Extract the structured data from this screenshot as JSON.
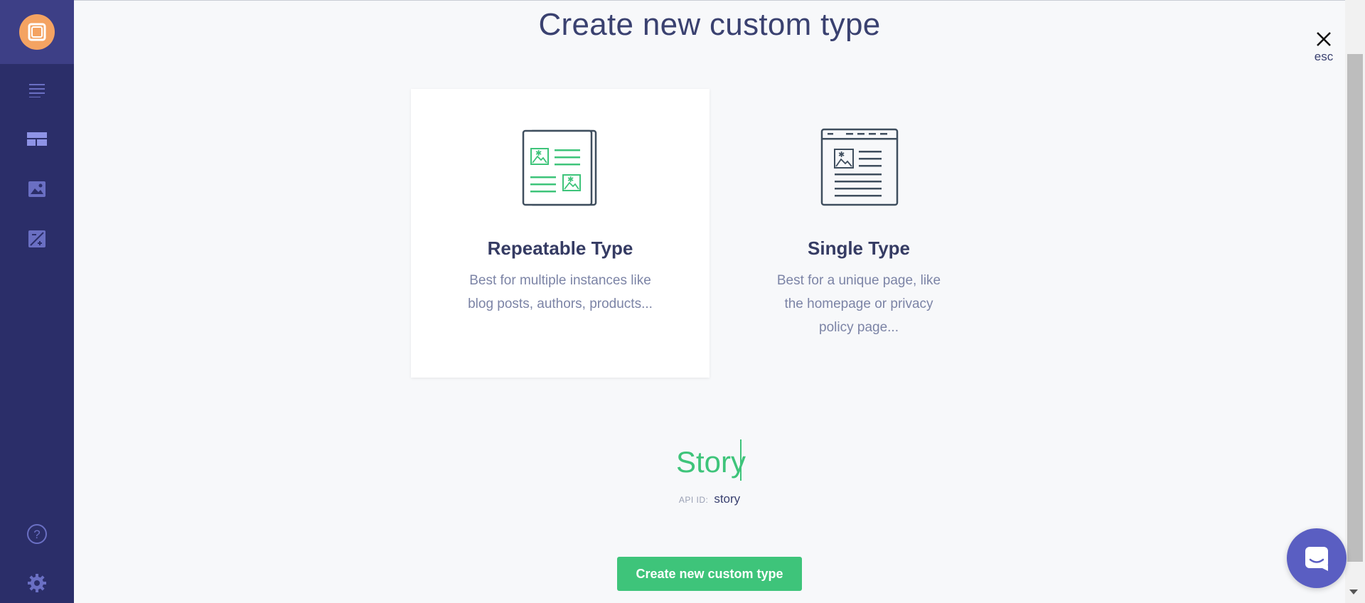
{
  "header": {
    "title": "Create new custom type",
    "close_label": "esc"
  },
  "cards": [
    {
      "title": "Repeatable Type",
      "description": "Best for multiple instances like blog posts, authors, products...",
      "selected": true,
      "icon": "repeatable-type-icon"
    },
    {
      "title": "Single Type",
      "description": "Best for a unique page, like the homepage or privacy policy page...",
      "selected": false,
      "icon": "single-type-icon"
    }
  ],
  "form": {
    "name_value": "Story",
    "api_id_label": "API ID:",
    "api_id_value": "story"
  },
  "actions": {
    "create_label": "Create new custom type"
  },
  "sidebar": {
    "items": [
      "documents-icon",
      "custom-types-icon",
      "media-icon",
      "settings-edit-icon"
    ],
    "bottom": [
      "help-icon",
      "gear-icon"
    ]
  },
  "colors": {
    "sidebar": "#2b2e69",
    "accent_green": "#3ec47a",
    "logo": "#f4a362",
    "chat": "#5a5ec2"
  }
}
